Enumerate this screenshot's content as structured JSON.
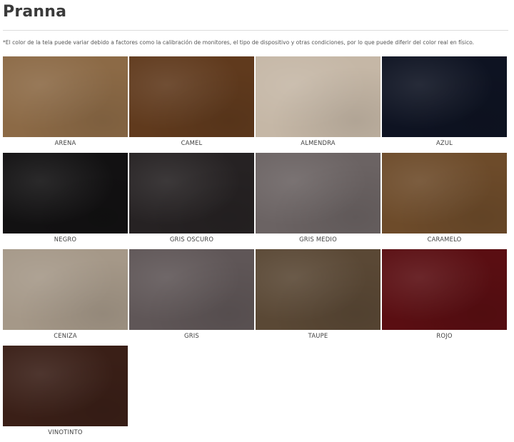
{
  "header": {
    "title": "Pranna"
  },
  "disclaimer": "*El color de la tela puede variar debido a factores como la calibración de monitores, el tipo de dispositivo y otras condiciones, por lo que puede diferir del color real en físico.",
  "swatches": [
    {
      "label": "ARENA",
      "color": "#8c6a46"
    },
    {
      "label": "CAMEL",
      "color": "#603a1d"
    },
    {
      "label": "ALMENDRA",
      "color": "#c5b7a6"
    },
    {
      "label": "AZUL",
      "color": "#0e1322"
    },
    {
      "label": "NEGRO",
      "color": "#121112"
    },
    {
      "label": "GRIS OSCURO",
      "color": "#262223"
    },
    {
      "label": "GRIS MEDIO",
      "color": "#6b6363"
    },
    {
      "label": "CARAMELO",
      "color": "#6d4b2a"
    },
    {
      "label": "CENIZA",
      "color": "#a59888"
    },
    {
      "label": "GRIS",
      "color": "#5f5657"
    },
    {
      "label": "TAUPE",
      "color": "#5a4835"
    },
    {
      "label": "ROJO",
      "color": "#5a0e12"
    },
    {
      "label": "VINOTINTO",
      "color": "#3a1f17"
    }
  ]
}
